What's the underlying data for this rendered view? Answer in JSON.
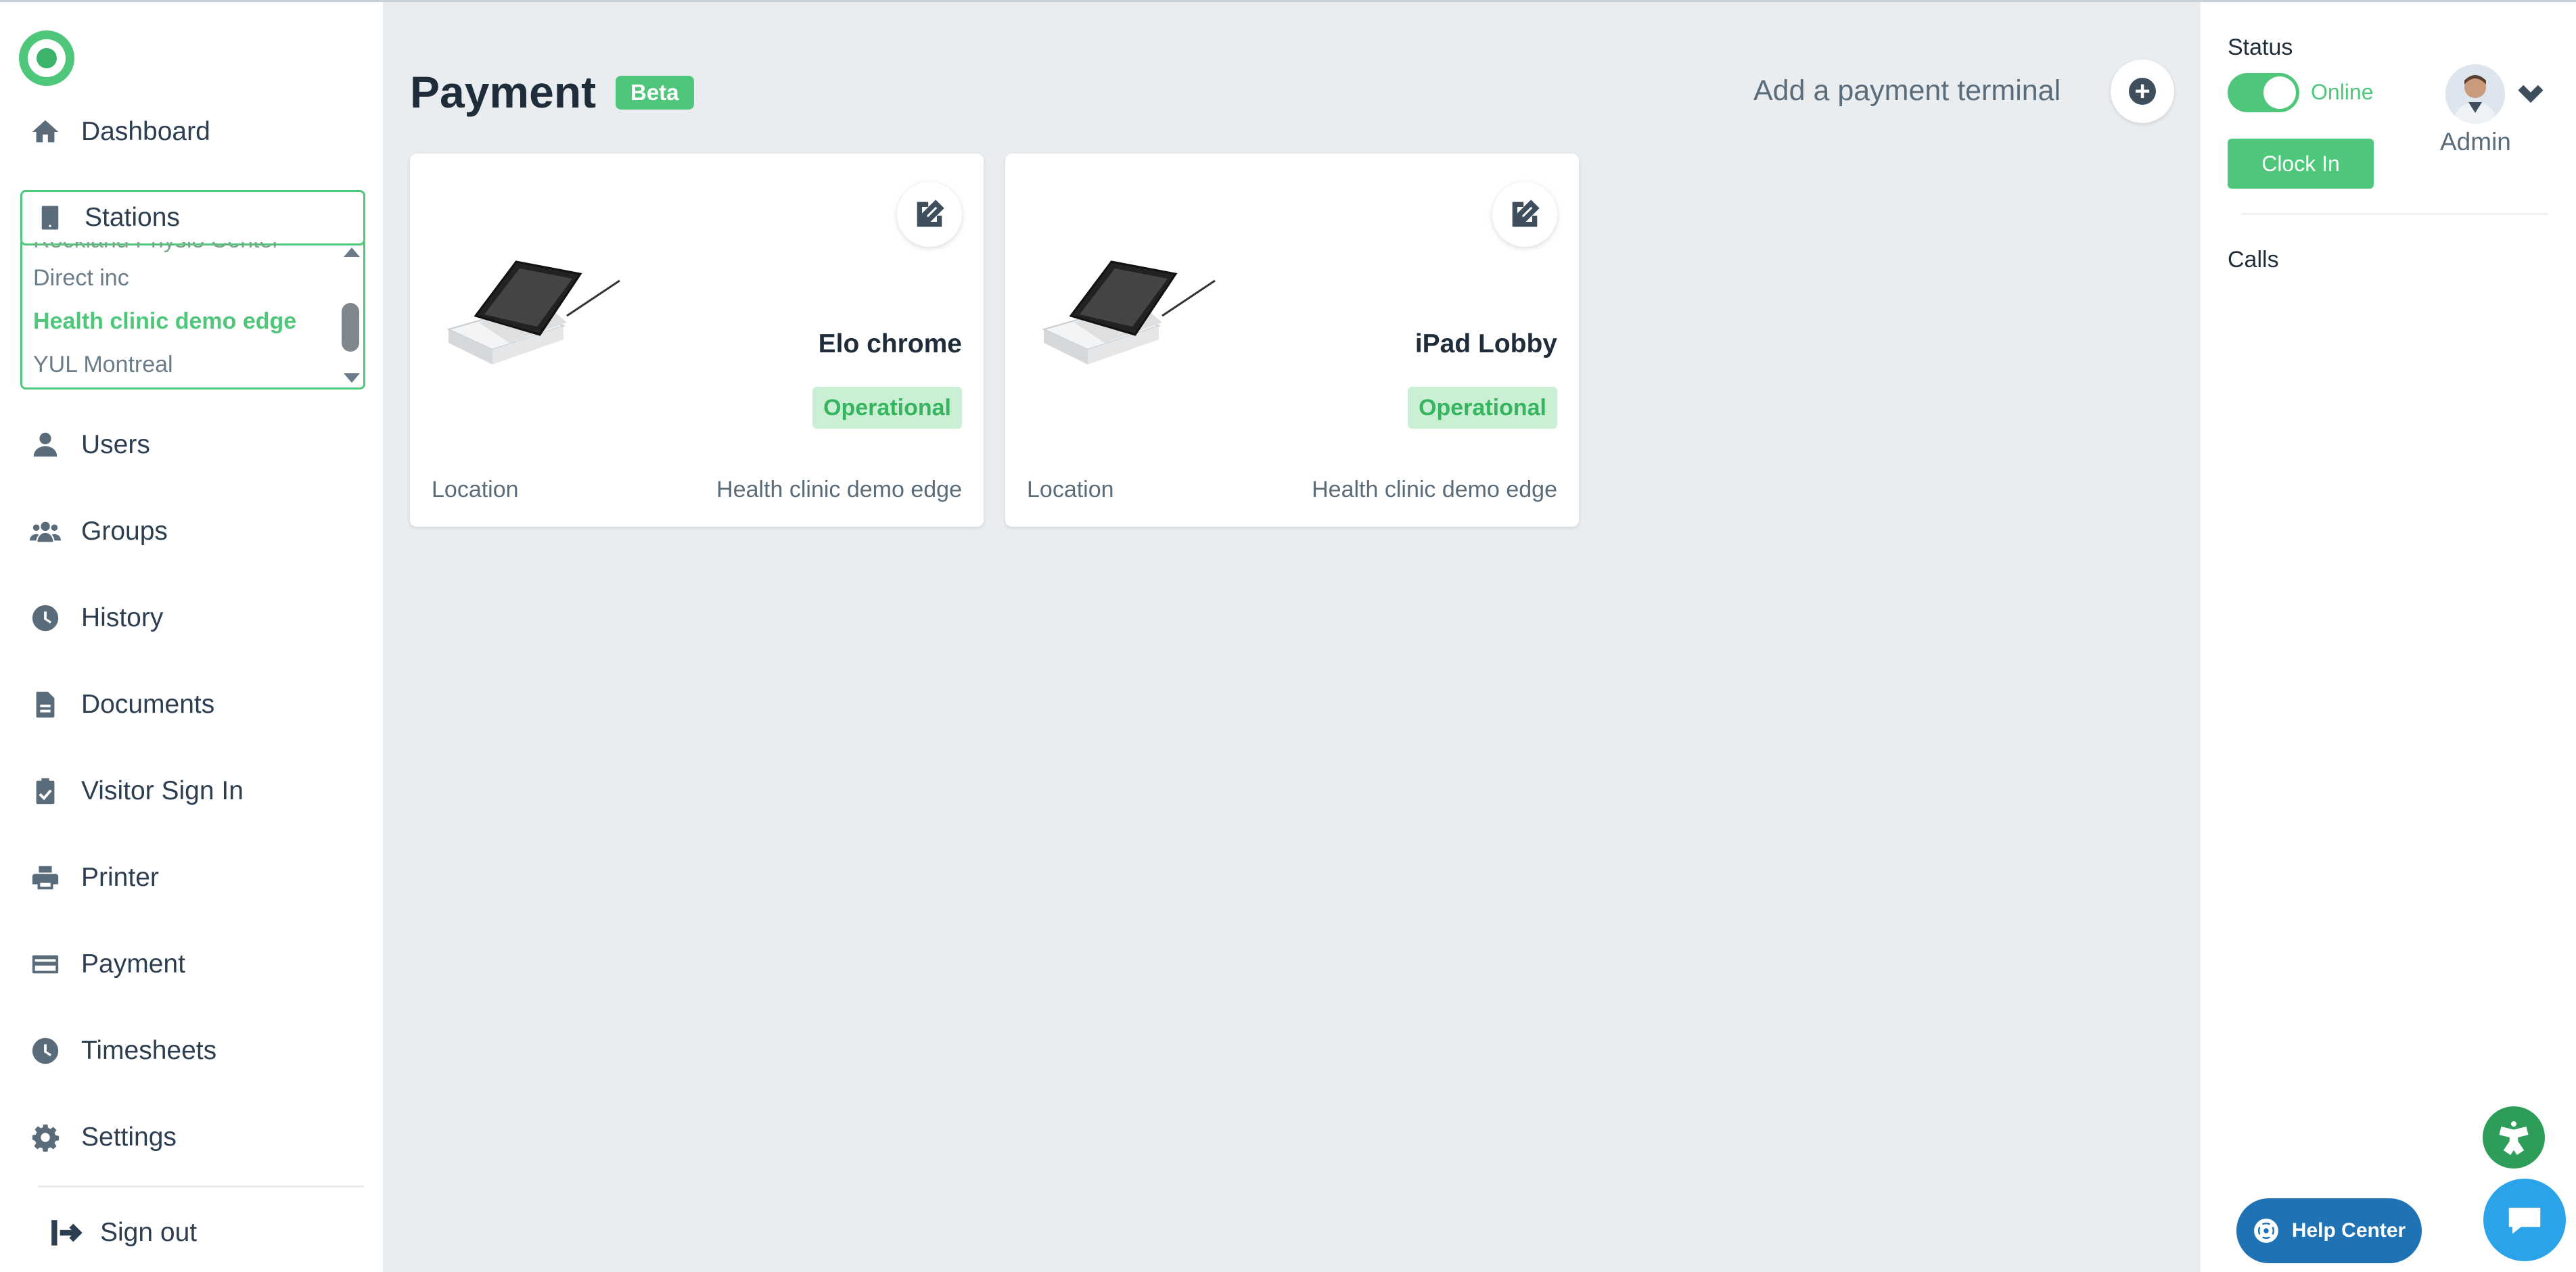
{
  "sidebar": {
    "nav": [
      {
        "label": "Dashboard",
        "icon": "home-icon"
      },
      {
        "label": "Users",
        "icon": "user-icon"
      },
      {
        "label": "Groups",
        "icon": "group-icon"
      },
      {
        "label": "History",
        "icon": "clock-icon"
      },
      {
        "label": "Documents",
        "icon": "document-icon"
      },
      {
        "label": "Visitor Sign In",
        "icon": "clipboard-check-icon"
      },
      {
        "label": "Printer",
        "icon": "printer-icon"
      },
      {
        "label": "Payment",
        "icon": "credit-card-icon"
      },
      {
        "label": "Timesheets",
        "icon": "clock-icon"
      },
      {
        "label": "Settings",
        "icon": "gear-icon"
      }
    ],
    "stations": {
      "label": "Stations",
      "options": [
        "Rockland Physio Center",
        "Direct inc",
        "Health clinic demo edge",
        "YUL Montreal"
      ],
      "selected": "Health clinic demo edge"
    },
    "signout": "Sign out"
  },
  "main": {
    "title": "Payment",
    "badge": "Beta",
    "add_terminal_label": "Add a payment terminal",
    "cards": [
      {
        "name": "Elo chrome",
        "status": "Operational",
        "location_label": "Location",
        "location": "Health clinic demo edge"
      },
      {
        "name": "iPad Lobby",
        "status": "Operational",
        "location_label": "Location",
        "location": "Health clinic demo edge"
      }
    ]
  },
  "right_panel": {
    "status_label": "Status",
    "status_value": "Online",
    "clock_in": "Clock In",
    "user": "Admin",
    "calls": "Calls"
  },
  "widgets": {
    "help_center": "Help Center"
  },
  "colors": {
    "accent": "#4fc77a",
    "background": "#e9edf0",
    "help": "#1f73b4",
    "chat": "#2aa3e8"
  }
}
